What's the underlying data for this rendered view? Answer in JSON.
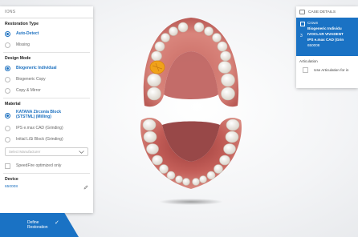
{
  "left_panel": {
    "header": "IONS",
    "restoration_type": {
      "title": "Restoration Type",
      "options": [
        {
          "label": "Auto-Detect",
          "selected": true
        },
        {
          "label": "Missing",
          "selected": false
        }
      ]
    },
    "design_mode": {
      "title": "Design Mode",
      "options": [
        {
          "label": "Biogeneric Individual",
          "selected": true
        },
        {
          "label": "Biogeneric Copy",
          "selected": false
        },
        {
          "label": "Copy & Mirror",
          "selected": false
        }
      ]
    },
    "material": {
      "title": "Material",
      "options": [
        {
          "label_line1": "KATANA Zirconia Block",
          "label_line2": "(STSTML) (Milling)",
          "selected": true
        },
        {
          "label": "IPS e.max CAD (Grinding)",
          "selected": false
        },
        {
          "label": "Initial LiSi Block (Grinding)",
          "selected": false
        }
      ],
      "select_placeholder": "Select Manufacturer"
    },
    "speedfire_label": "SpeedFire optimized only",
    "device": {
      "title": "Device",
      "value": "650008"
    }
  },
  "define_button": {
    "line1": "Define",
    "line2": "Restoration",
    "check_icon": "check-icon"
  },
  "case_details": {
    "title": "CASE DETAILS",
    "tooth_number": "3",
    "line1": "Crown",
    "line2": "Biogeneric Individu",
    "line3": "IVOCLAR VIVADENT",
    "line4": "IPS e.max CAD (Grin",
    "line5": "650008",
    "articulation_title": "Articulation",
    "articulation_option": "Use Articulation for in"
  },
  "colors": {
    "accent": "#1a72c4",
    "selected_tooth": "#f0a21a",
    "gum": "#d8776e",
    "tooth": "#f1ece4"
  }
}
